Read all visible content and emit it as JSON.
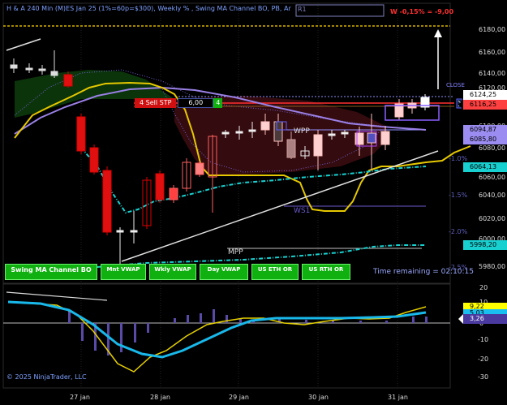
{
  "title": "H & A 240 Min (M)ES Jan 25  (1%=60p=$300), Weekly % , Swing MA Channel BO, PB, Ar",
  "top_right_signal": "W -0,15% = -9,00",
  "top_right_label": "R1",
  "close_label": "CLOSE",
  "sell_order": {
    "label": "4 Sell STP",
    "value": "6,00",
    "qty": "4"
  },
  "level_labels": {
    "wpp": "WPP",
    "ws1": "WS1",
    "mpp": "MPP"
  },
  "percent_labels": [
    "-1.0%",
    "-1.5%",
    "-2.0%",
    "-2.5%"
  ],
  "time_remaining": "Time remaining = 02:10:15",
  "copyright": "© 2025 NinjaTrader, LLC",
  "buttons": [
    "Swing MA Channel BO",
    "Mnt VWAP",
    "Wkly VWAP",
    "Day VWAP",
    "US ETH OR",
    "US RTH OR"
  ],
  "price_axis": {
    "ticks": [
      "6180,00",
      "6160,00",
      "6140,00",
      "6120,00",
      "6100,00",
      "6080,00",
      "6060,00",
      "6040,00",
      "6020,00",
      "6000,00",
      "5980,00"
    ],
    "tags": [
      {
        "text": "6124,25",
        "bg": "#ffffff",
        "fg": "#000000"
      },
      {
        "text": "6116,25",
        "bg": "#ff4040",
        "fg": "#000000"
      },
      {
        "text": "6094,87",
        "bg": "#9a8cf0",
        "fg": "#000000"
      },
      {
        "text": "6085,80",
        "bg": "#9a8cf0",
        "fg": "#000000"
      },
      {
        "text": "6064,13",
        "bg": "#19d0d0",
        "fg": "#000000"
      },
      {
        "text": "5998,20",
        "bg": "#19d0d0",
        "fg": "#000000"
      }
    ]
  },
  "osc_axis": {
    "ticks": [
      "20",
      "10",
      "0",
      "-10",
      "-20",
      "-30"
    ],
    "tags": [
      {
        "text": "9,22",
        "bg": "#ffff00",
        "fg": "#000000"
      },
      {
        "text": "5,03",
        "bg": "#19bff0",
        "fg": "#000000"
      },
      {
        "text": "3,26",
        "bg": "#4a3aa0",
        "fg": "#ffffff"
      }
    ]
  },
  "date_axis": [
    "27 jan",
    "28 jan",
    "29 jan",
    "30 jan",
    "31 jan"
  ]
}
